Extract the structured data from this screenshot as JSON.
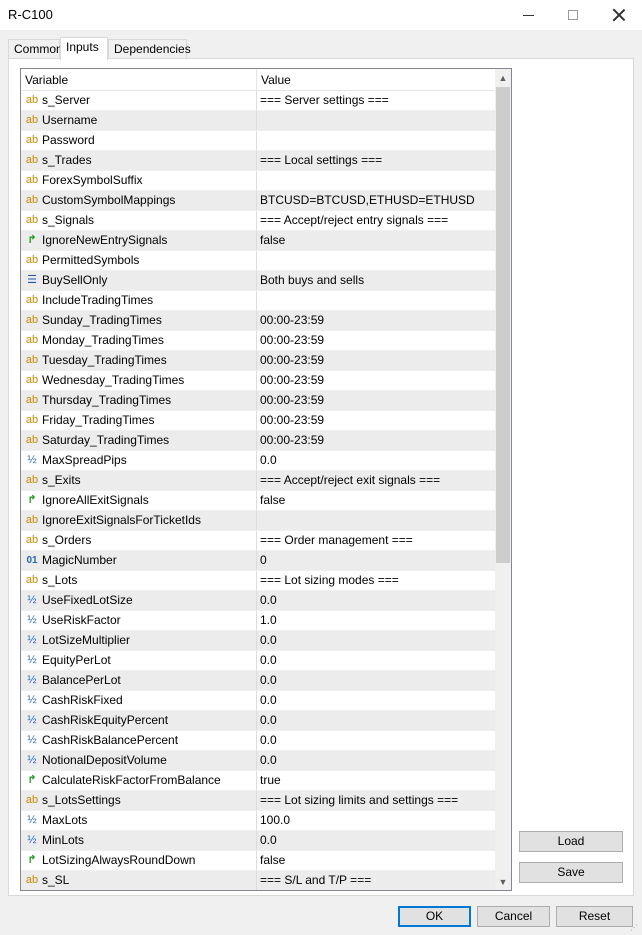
{
  "window": {
    "title": "R-C100",
    "minimize_glyph": "",
    "maximize_glyph": "",
    "close_glyph": ""
  },
  "tabs": [
    {
      "label": "Common"
    },
    {
      "label": "Inputs"
    },
    {
      "label": "Dependencies"
    }
  ],
  "grid": {
    "col_variable": "Variable",
    "col_value": "Value",
    "rows": [
      {
        "icon": "ab",
        "name": "s_Server",
        "value": "=== Server settings ==="
      },
      {
        "icon": "ab",
        "name": "Username",
        "value": ""
      },
      {
        "icon": "ab",
        "name": "Password",
        "value": ""
      },
      {
        "icon": "ab",
        "name": "s_Trades",
        "value": "=== Local settings ==="
      },
      {
        "icon": "ab",
        "name": "ForexSymbolSuffix",
        "value": ""
      },
      {
        "icon": "ab",
        "name": "CustomSymbolMappings",
        "value": "BTCUSD=BTCUSD,ETHUSD=ETHUSD"
      },
      {
        "icon": "ab",
        "name": "s_Signals",
        "value": "=== Accept/reject entry signals ==="
      },
      {
        "icon": "bool",
        "name": "IgnoreNewEntrySignals",
        "value": "false"
      },
      {
        "icon": "ab",
        "name": "PermittedSymbols",
        "value": ""
      },
      {
        "icon": "enum",
        "name": "BuySellOnly",
        "value": "Both buys and sells"
      },
      {
        "icon": "ab",
        "name": "IncludeTradingTimes",
        "value": ""
      },
      {
        "icon": "ab",
        "name": "Sunday_TradingTimes",
        "value": "00:00-23:59"
      },
      {
        "icon": "ab",
        "name": "Monday_TradingTimes",
        "value": "00:00-23:59"
      },
      {
        "icon": "ab",
        "name": "Tuesday_TradingTimes",
        "value": "00:00-23:59"
      },
      {
        "icon": "ab",
        "name": "Wednesday_TradingTimes",
        "value": "00:00-23:59"
      },
      {
        "icon": "ab",
        "name": "Thursday_TradingTimes",
        "value": "00:00-23:59"
      },
      {
        "icon": "ab",
        "name": "Friday_TradingTimes",
        "value": "00:00-23:59"
      },
      {
        "icon": "ab",
        "name": "Saturday_TradingTimes",
        "value": "00:00-23:59"
      },
      {
        "icon": "frac",
        "name": "MaxSpreadPips",
        "value": "0.0"
      },
      {
        "icon": "ab",
        "name": "s_Exits",
        "value": "=== Accept/reject exit signals ==="
      },
      {
        "icon": "bool",
        "name": "IgnoreAllExitSignals",
        "value": "false"
      },
      {
        "icon": "ab",
        "name": "IgnoreExitSignalsForTicketIds",
        "value": ""
      },
      {
        "icon": "ab",
        "name": "s_Orders",
        "value": "=== Order management ==="
      },
      {
        "icon": "int",
        "name": "MagicNumber",
        "value": "0"
      },
      {
        "icon": "ab",
        "name": "s_Lots",
        "value": "=== Lot sizing modes ==="
      },
      {
        "icon": "frac",
        "name": "UseFixedLotSize",
        "value": "0.0"
      },
      {
        "icon": "frac",
        "name": "UseRiskFactor",
        "value": "1.0"
      },
      {
        "icon": "frac",
        "name": "LotSizeMultiplier",
        "value": "0.0"
      },
      {
        "icon": "frac",
        "name": "EquityPerLot",
        "value": "0.0"
      },
      {
        "icon": "frac",
        "name": "BalancePerLot",
        "value": "0.0"
      },
      {
        "icon": "frac",
        "name": "CashRiskFixed",
        "value": "0.0"
      },
      {
        "icon": "frac",
        "name": "CashRiskEquityPercent",
        "value": "0.0"
      },
      {
        "icon": "frac",
        "name": "CashRiskBalancePercent",
        "value": "0.0"
      },
      {
        "icon": "frac",
        "name": "NotionalDepositVolume",
        "value": "0.0"
      },
      {
        "icon": "bool",
        "name": "CalculateRiskFactorFromBalance",
        "value": "true"
      },
      {
        "icon": "ab",
        "name": "s_LotsSettings",
        "value": "=== Lot sizing limits and settings ==="
      },
      {
        "icon": "frac",
        "name": "MaxLots",
        "value": "100.0"
      },
      {
        "icon": "frac",
        "name": "MinLots",
        "value": "0.0"
      },
      {
        "icon": "bool",
        "name": "LotSizingAlwaysRoundDown",
        "value": "false"
      },
      {
        "icon": "ab",
        "name": "s_SL",
        "value": "=== S/L and T/P ==="
      }
    ]
  },
  "icons": {
    "ab": "ab",
    "bool": "↱",
    "enum": "☰",
    "frac": "½",
    "int": "01"
  },
  "buttons": {
    "load": "Load",
    "save": "Save",
    "ok": "OK",
    "cancel": "Cancel",
    "reset": "Reset"
  }
}
